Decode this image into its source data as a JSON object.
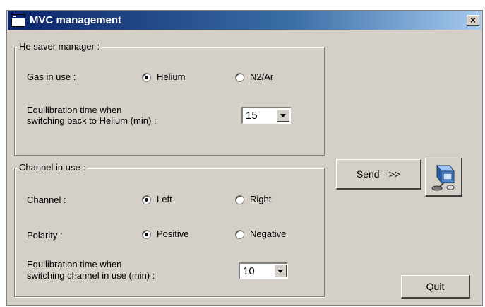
{
  "window": {
    "title": "MVC management",
    "close_glyph": "×"
  },
  "he_saver": {
    "legend": "He saver manager :",
    "gas_label": "Gas in use :",
    "gas_options": [
      {
        "label": "Helium",
        "checked": true
      },
      {
        "label": "N2/Ar",
        "checked": false
      }
    ],
    "equil_label_line1": "Equilibration time when",
    "equil_label_line2": "switching back to Helium (min) :",
    "equil_value": "15"
  },
  "channel": {
    "legend": "Channel in use :",
    "channel_label": "Channel :",
    "channel_options": [
      {
        "label": "Left",
        "checked": true
      },
      {
        "label": "Right",
        "checked": false
      }
    ],
    "polarity_label": "Polarity :",
    "polarity_options": [
      {
        "label": "Positive",
        "checked": true
      },
      {
        "label": "Negative",
        "checked": false
      }
    ],
    "equil_label_line1": "Equilibration time when",
    "equil_label_line2": "switching channel in use (min) :",
    "equil_value": "10"
  },
  "actions": {
    "send_label": "Send -->>",
    "send_icon": "network-computer-icon",
    "quit_label": "Quit"
  }
}
